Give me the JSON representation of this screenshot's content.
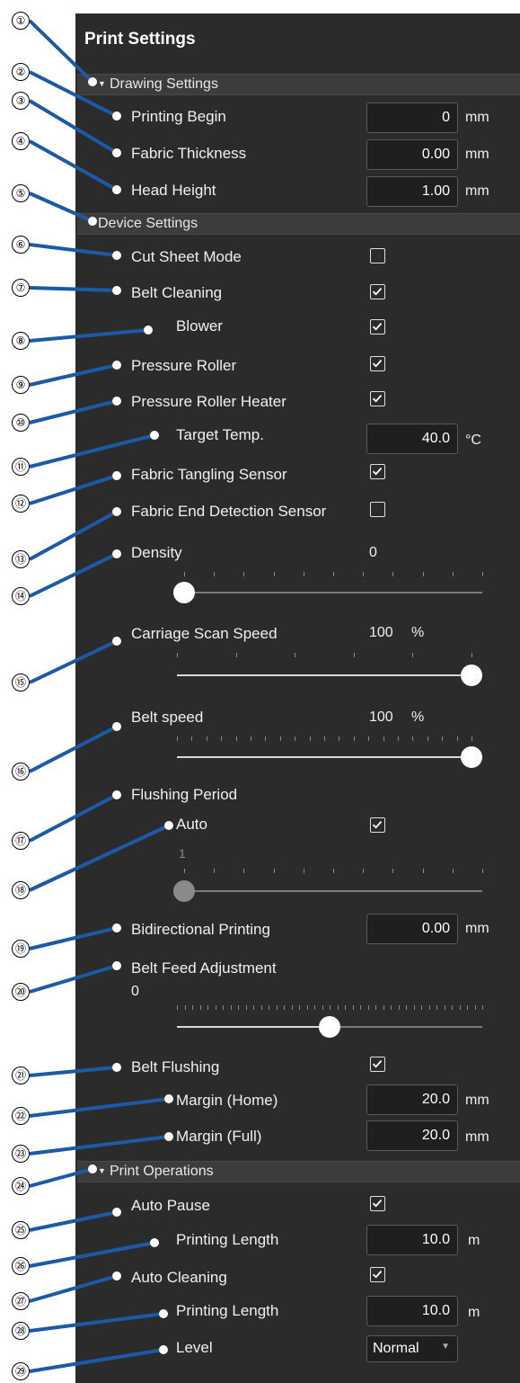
{
  "panel": {
    "title": "Print Settings",
    "sections": {
      "drawing": "Drawing Settings",
      "device": "Device Settings",
      "operations": "Print Operations"
    }
  },
  "drawing": {
    "printing_begin": {
      "label": "Printing Begin",
      "value": "0",
      "unit": "mm"
    },
    "fabric_thickness": {
      "label": "Fabric Thickness",
      "value": "0.00",
      "unit": "mm"
    },
    "head_height": {
      "label": "Head Height",
      "value": "1.00",
      "unit": "mm"
    }
  },
  "device": {
    "cut_sheet_mode": {
      "label": "Cut Sheet Mode",
      "checked": false
    },
    "belt_cleaning": {
      "label": "Belt Cleaning",
      "checked": true
    },
    "blower": {
      "label": "Blower",
      "checked": true
    },
    "pressure_roller": {
      "label": "Pressure Roller",
      "checked": true
    },
    "pressure_roller_heater": {
      "label": "Pressure Roller Heater",
      "checked": true
    },
    "target_temp": {
      "label": "Target Temp.",
      "value": "40.0",
      "unit": "°C"
    },
    "fabric_tangling_sensor": {
      "label": "Fabric Tangling Sensor",
      "checked": true
    },
    "fabric_end_detection_sensor": {
      "label": "Fabric End Detection Sensor",
      "checked": false
    },
    "density": {
      "label": "Density",
      "value": "0",
      "slider_fraction": 0.0
    },
    "carriage_scan_speed": {
      "label": "Carriage Scan Speed",
      "value": "100",
      "unit": "%",
      "slider_fraction": 1.0
    },
    "belt_speed": {
      "label": "Belt speed",
      "value": "100",
      "unit": "%",
      "slider_fraction": 1.0
    },
    "flushing_period": {
      "label": "Flushing Period",
      "auto_label": "Auto",
      "auto_checked": true,
      "value": "1",
      "slider_fraction": 0.0
    },
    "bidirectional_printing": {
      "label": "Bidirectional Printing",
      "value": "0.00",
      "unit": "mm"
    },
    "belt_feed_adjustment": {
      "label": "Belt Feed Adjustment",
      "value": "0",
      "slider_fraction": 0.5
    },
    "belt_flushing": {
      "label": "Belt Flushing",
      "checked": true
    },
    "margin_home": {
      "label": "Margin (Home)",
      "value": "20.0",
      "unit": "mm"
    },
    "margin_full": {
      "label": "Margin (Full)",
      "value": "20.0",
      "unit": "mm"
    }
  },
  "operations": {
    "auto_pause": {
      "label": "Auto Pause",
      "checked": true
    },
    "pause_length": {
      "label": "Printing Length",
      "value": "10.0",
      "unit": "m"
    },
    "auto_cleaning": {
      "label": "Auto Cleaning",
      "checked": true
    },
    "cleaning_length": {
      "label": "Printing Length",
      "value": "10.0",
      "unit": "m"
    },
    "level": {
      "label": "Level",
      "selected": "Normal"
    }
  },
  "callout_numbers": [
    "①",
    "②",
    "③",
    "④",
    "⑤",
    "⑥",
    "⑦",
    "⑧",
    "⑨",
    "⑩",
    "⑪",
    "⑫",
    "⑬",
    "⑭",
    "⑮",
    "⑯",
    "⑰",
    "⑱",
    "⑲",
    "⑳",
    "㉑",
    "㉒",
    "㉓",
    "㉔",
    "㉕",
    "㉖",
    "㉗",
    "㉘",
    "㉙"
  ]
}
